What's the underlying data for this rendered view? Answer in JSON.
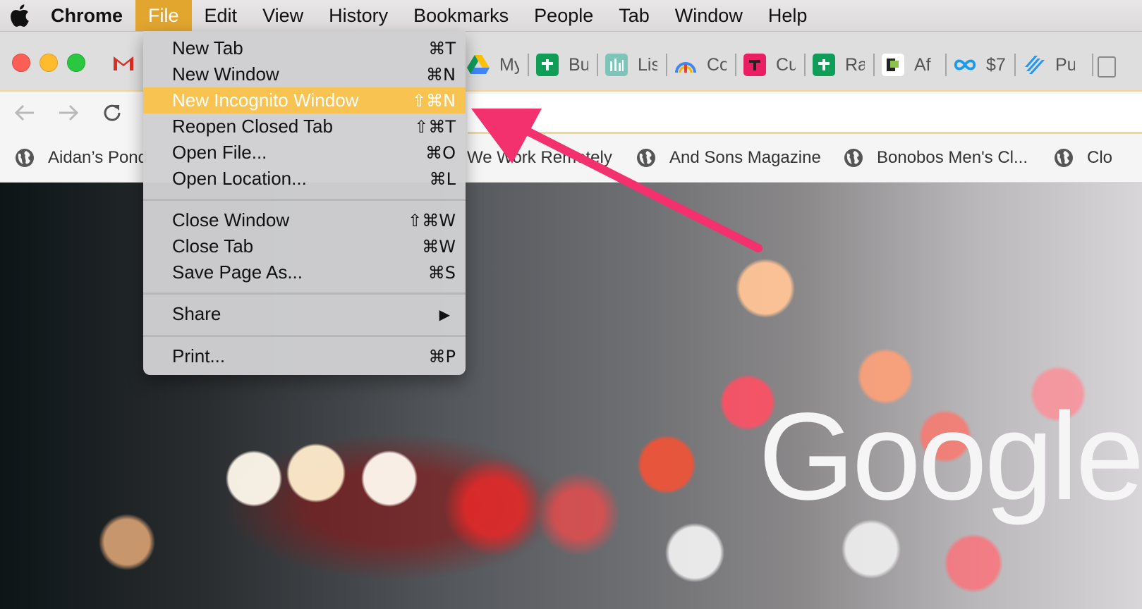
{
  "menubar": {
    "app_name": "Chrome",
    "items": [
      "File",
      "Edit",
      "View",
      "History",
      "Bookmarks",
      "People",
      "Tab",
      "Window",
      "Help"
    ],
    "active_item": "File"
  },
  "file_menu": {
    "groups": [
      [
        {
          "label": "New Tab",
          "shortcut": "⌘T"
        },
        {
          "label": "New Window",
          "shortcut": "⌘N"
        },
        {
          "label": "New Incognito Window",
          "shortcut": "⇧⌘N",
          "highlighted": true
        },
        {
          "label": "Reopen Closed Tab",
          "shortcut": "⇧⌘T"
        },
        {
          "label": "Open File...",
          "shortcut": "⌘O"
        },
        {
          "label": "Open Location...",
          "shortcut": "⌘L"
        }
      ],
      [
        {
          "label": "Close Window",
          "shortcut": "⇧⌘W"
        },
        {
          "label": "Close Tab",
          "shortcut": "⌘W"
        },
        {
          "label": "Save Page As...",
          "shortcut": "⌘S"
        }
      ],
      [
        {
          "label": "Share",
          "shortcut": "▶"
        }
      ],
      [
        {
          "label": "Print...",
          "shortcut": "⌘P"
        }
      ]
    ]
  },
  "tabs": [
    {
      "label": "My",
      "icon": "google-drive-icon"
    },
    {
      "label": "Bu",
      "icon": "green-plus-icon",
      "color": "#0f9d58"
    },
    {
      "label": "Lis",
      "icon": "chart-icon",
      "color": "#7fc4b8"
    },
    {
      "label": "Co",
      "icon": "gauge-icon"
    },
    {
      "label": "Cu",
      "icon": "tools-icon",
      "color": "#e91e63"
    },
    {
      "label": "Ra",
      "icon": "green-plus-icon",
      "color": "#0f9d58"
    },
    {
      "label": "Af",
      "icon": "p-logo-icon"
    },
    {
      "label": "$7",
      "icon": "infinity-icon",
      "color": "#1a9bf0"
    },
    {
      "label": "Pu",
      "icon": "slashes-icon",
      "color": "#2196f3"
    }
  ],
  "bookmarks": [
    {
      "label": "Aidan’s Pond"
    },
    {
      "label": "We Work Remotely"
    },
    {
      "label": "And Sons Magazine"
    },
    {
      "label": "Bonobos Men's Cl..."
    },
    {
      "label": "Clo"
    }
  ],
  "page": {
    "logo_text": "Google"
  },
  "colors": {
    "menu_highlight": "#f9c351",
    "menubar_active": "#e2a52e",
    "arrow": "#f2316e"
  }
}
